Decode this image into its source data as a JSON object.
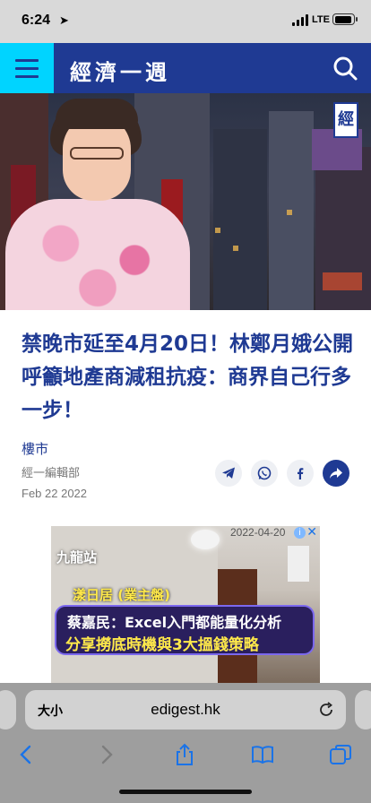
{
  "status_bar": {
    "time": "6:24",
    "network": "LTE"
  },
  "header": {
    "logo_text": "經濟一週",
    "menu_icon": "hamburger-menu-icon",
    "search_icon": "search-icon"
  },
  "hero": {
    "badge_text": "經"
  },
  "article": {
    "title": "禁晚市延至4月20日！林鄭月娥公開呼籲地產商減租抗疫：商界自己行多一步！",
    "category": "樓市",
    "author": "經一編輯部",
    "date": "Feb 22 2022",
    "share_buttons": [
      "telegram-icon",
      "whatsapp-icon",
      "facebook-icon",
      "share-arrow-icon"
    ]
  },
  "ad": {
    "date_tag": "2022-04-20",
    "station": "九龍站",
    "estate": "漾日居 (業主盤)",
    "headline_1": "蔡嘉民：Excel入門都能量化分析",
    "headline_2": "分享撈底時機與3大搵錢策略"
  },
  "browser": {
    "text_size_label": "大小",
    "url": "edigest.hk",
    "toolbar": [
      "back-icon",
      "forward-icon",
      "share-icon",
      "bookmarks-icon",
      "tabs-icon"
    ]
  },
  "colors": {
    "brand_blue": "#1f3a93",
    "accent_cyan": "#00d4ff"
  }
}
